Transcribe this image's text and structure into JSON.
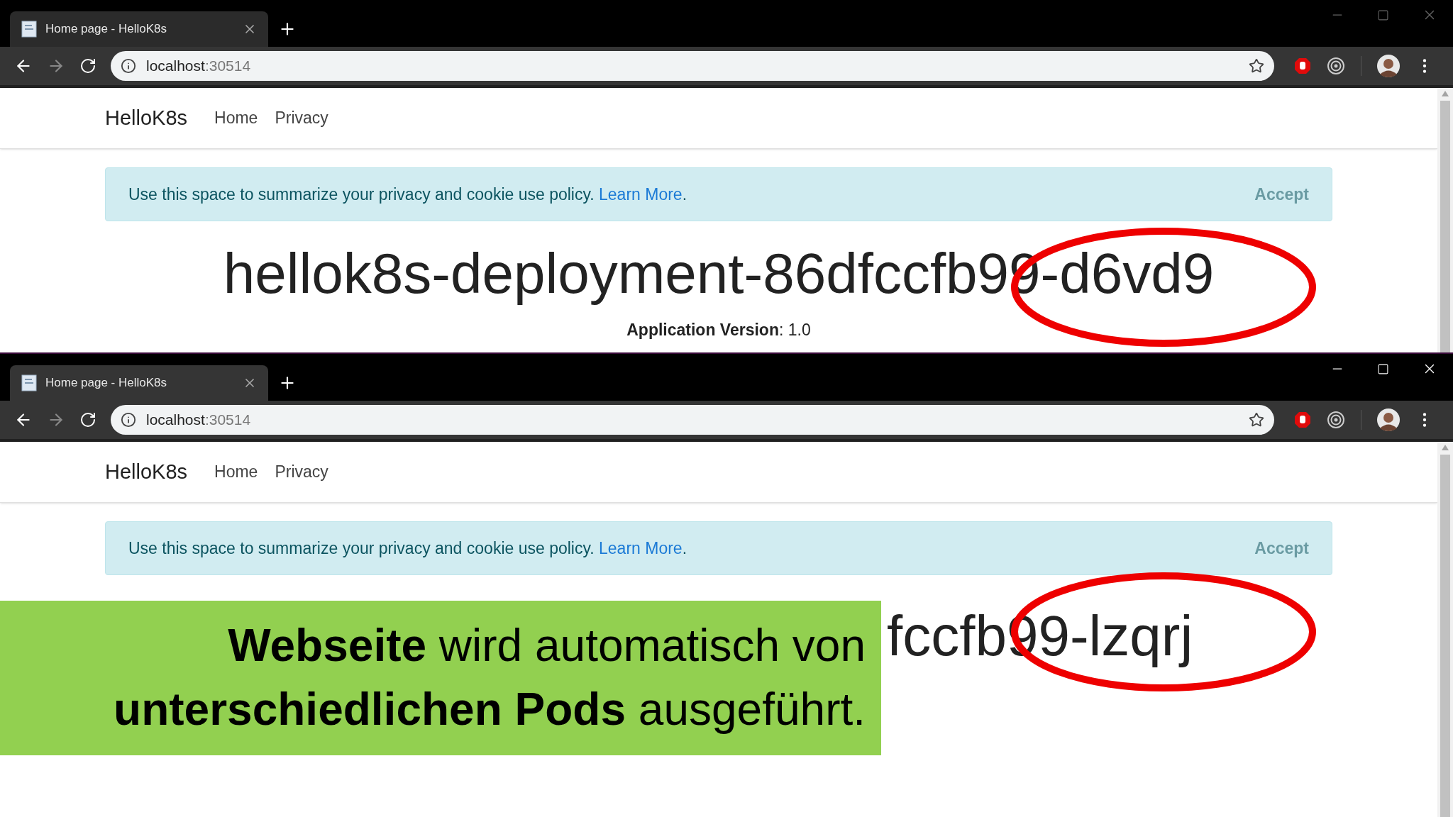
{
  "windows": [
    {
      "active": false,
      "tab": {
        "title": "Home page - HelloK8s"
      },
      "url": {
        "host": "localhost",
        "port": ":30514"
      },
      "page": {
        "brand": "HelloK8s",
        "nav": [
          "Home",
          "Privacy"
        ],
        "cookie": {
          "text": "Use this space to summarize your privacy and cookie use policy.",
          "link": "Learn More",
          "after": ".",
          "button": "Accept"
        },
        "heading": "hellok8s-deployment-86dfccfb99-d6vd9",
        "version": {
          "label": "Application Version",
          "value": ": 1.0"
        }
      }
    },
    {
      "active": true,
      "tab": {
        "title": "Home page - HelloK8s"
      },
      "url": {
        "host": "localhost",
        "port": ":30514"
      },
      "page": {
        "brand": "HelloK8s",
        "nav": [
          "Home",
          "Privacy"
        ],
        "cookie": {
          "text": "Use this space to summarize your privacy and cookie use policy.",
          "link": "Learn More",
          "after": ".",
          "button": "Accept"
        },
        "heading": "fccfb99-lzqrj"
      }
    }
  ],
  "caption": {
    "lines": [
      "**Webseite** wird automatisch von",
      "**unterschiedlichen Pods** ausgeführt."
    ]
  }
}
